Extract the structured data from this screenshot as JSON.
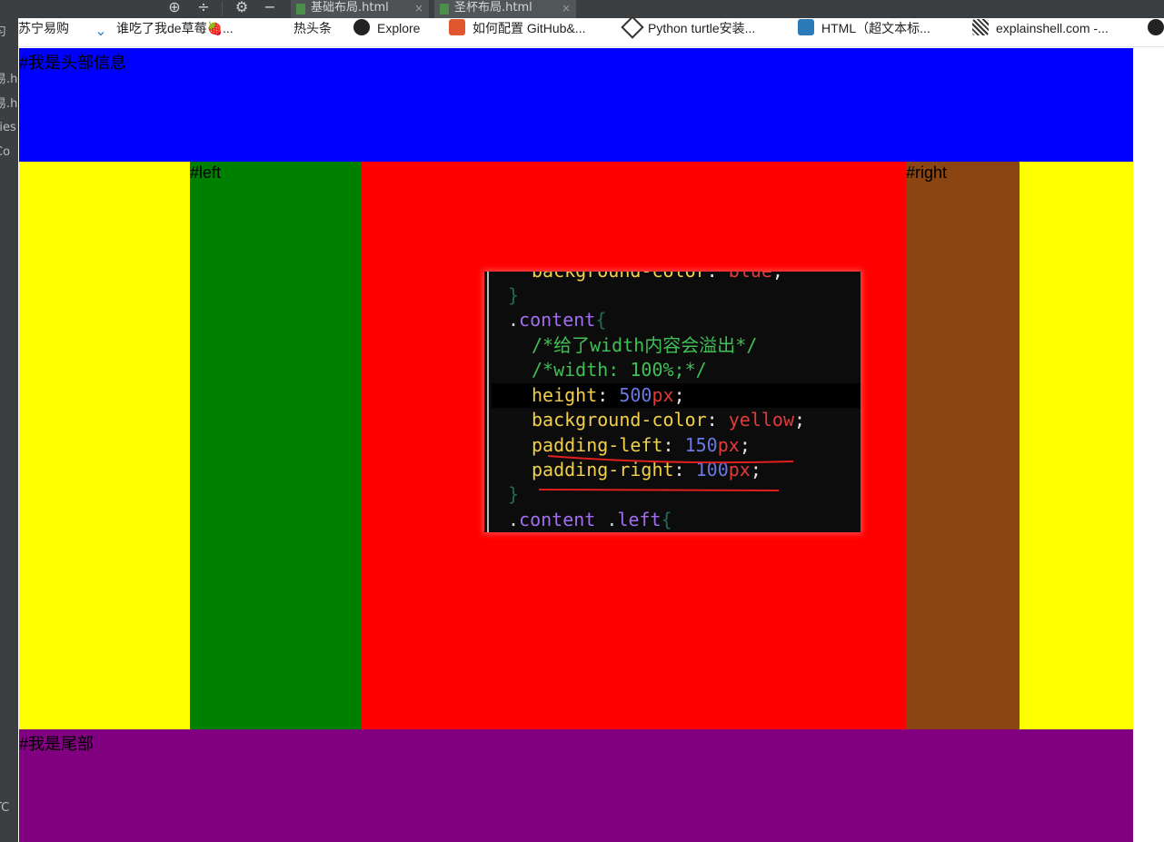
{
  "ide": {
    "gutter_labels": [
      "习",
      "易.h",
      "易.h",
      "ries",
      "Co",
      "TC"
    ],
    "tabs": [
      {
        "label": "基础布局.html",
        "close": "×"
      },
      {
        "label": "圣杯布局.html",
        "close": "×"
      }
    ]
  },
  "bookmarks": [
    {
      "label": "苏宁易购",
      "icon": "suning-icon"
    },
    {
      "label": "谁吃了我de草莓🍓...",
      "icon": "check-chevron-icon",
      "color": "#2f7fd6"
    },
    {
      "label": "热头条",
      "icon": "news-icon"
    },
    {
      "label": "Explore",
      "icon": "github-icon"
    },
    {
      "label": "如何配置 GitHub&...",
      "icon": "csdn-icon",
      "color": "#e0572f"
    },
    {
      "label": "Python turtle安装...",
      "icon": "bird-icon"
    },
    {
      "label": "HTML（超文本标...",
      "icon": "w3-icon",
      "color": "#2b7bb9"
    },
    {
      "label": "explainshell.com -...",
      "icon": "shell-icon"
    }
  ],
  "page": {
    "header_label": "#我是头部信息",
    "left_label": "#left",
    "right_label": "#right",
    "footer_label": "#我是尾部",
    "colors": {
      "header": "#0000ff",
      "content": "#ffff00",
      "left": "#008000",
      "center": "#ff0000",
      "right": "#8b4513",
      "footer": "#800080"
    }
  },
  "code_snippet": {
    "line0": {
      "prop": "background-color",
      "colon": ":",
      "val": "blue",
      "semi": ";"
    },
    "line1": {
      "brace": "}"
    },
    "line2": {
      "dot": ".",
      "sel": "content",
      "brace": "{"
    },
    "line3": {
      "cmt": "/*给了width内容会溢出*/"
    },
    "line4": {
      "cmt": "/*width: 100%;*/"
    },
    "line5": {
      "prop": "height",
      "colon": ":",
      "num": "500",
      "unit": "px",
      "semi": ";"
    },
    "line6": {
      "prop": "background-color",
      "colon": ":",
      "val": "yellow",
      "semi": ";"
    },
    "line7": {
      "prop": "padding-left",
      "colon": ":",
      "num": "150",
      "unit": "px",
      "semi": ";"
    },
    "line8": {
      "prop": "padding-right",
      "colon": ":",
      "num": "100",
      "unit": "px",
      "semi": ";"
    },
    "line9": {
      "brace": "}"
    },
    "line10": {
      "dot": ".",
      "sel": "content",
      "sp": " ",
      "dot2": ".",
      "sel2": "left",
      "brace": "{"
    }
  }
}
